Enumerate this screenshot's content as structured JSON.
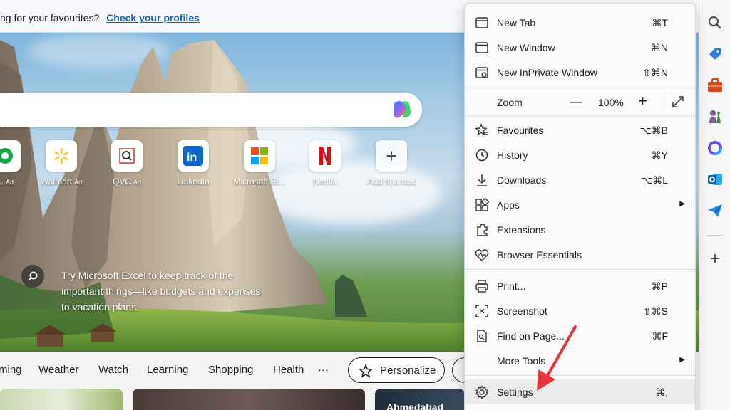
{
  "infobar": {
    "message": "ng for your favourites?",
    "link": "Check your profiles"
  },
  "tiles": [
    {
      "label": "...",
      "ad": "Ad",
      "icon": "green-circle-icon"
    },
    {
      "label": "Walmart",
      "ad": "Ad",
      "icon": "walmart-icon"
    },
    {
      "label": "QVC",
      "ad": "Ad",
      "icon": "qvc-icon"
    },
    {
      "label": "LinkedIn",
      "ad": "",
      "icon": "linkedin-icon"
    },
    {
      "label": "Microsoft St...",
      "ad": "",
      "icon": "microsoft-store-icon"
    },
    {
      "label": "Netflix",
      "ad": "",
      "icon": "netflix-icon"
    },
    {
      "label": "Add shortcut",
      "ad": "",
      "icon": "plus-icon"
    }
  ],
  "tip": {
    "text": "Try Microsoft Excel to keep track of the important things—like budgets and expenses to vacation plans."
  },
  "feed_nav": {
    "items": [
      "ming",
      "Weather",
      "Watch",
      "Learning",
      "Shopping",
      "Health",
      "···"
    ],
    "personalize": "Personalize"
  },
  "cards": {
    "card3_title": "Ahmedabad"
  },
  "menu": {
    "new_tab": {
      "label": "New Tab",
      "shortcut": "⌘T"
    },
    "new_window": {
      "label": "New Window",
      "shortcut": "⌘N"
    },
    "new_inprivate": {
      "label": "New InPrivate Window",
      "shortcut": "⇧⌘N"
    },
    "zoom": {
      "label": "Zoom",
      "minus": "—",
      "value": "100%",
      "plus": "+"
    },
    "favourites": {
      "label": "Favourites",
      "shortcut": "⌥⌘B"
    },
    "history": {
      "label": "History",
      "shortcut": "⌘Y"
    },
    "downloads": {
      "label": "Downloads",
      "shortcut": "⌥⌘L"
    },
    "apps": {
      "label": "Apps"
    },
    "extensions": {
      "label": "Extensions"
    },
    "browser_essentials": {
      "label": "Browser Essentials"
    },
    "print": {
      "label": "Print...",
      "shortcut": "⌘P"
    },
    "screenshot": {
      "label": "Screenshot",
      "shortcut": "⇧⌘S"
    },
    "find_on_page": {
      "label": "Find on Page...",
      "shortcut": "⌘F"
    },
    "more_tools": {
      "label": "More Tools"
    },
    "settings": {
      "label": "Settings",
      "shortcut": "⌘,"
    }
  },
  "sidebar_icons": [
    "search-icon",
    "tag-icon",
    "briefcase-icon",
    "chess-icon",
    "copilot-icon",
    "outlook-icon",
    "send-icon",
    "add-icon"
  ],
  "colors": {
    "link": "#1a5fb4",
    "annotation_arrow": "#e8323c",
    "menu_highlight": "#ececec"
  }
}
